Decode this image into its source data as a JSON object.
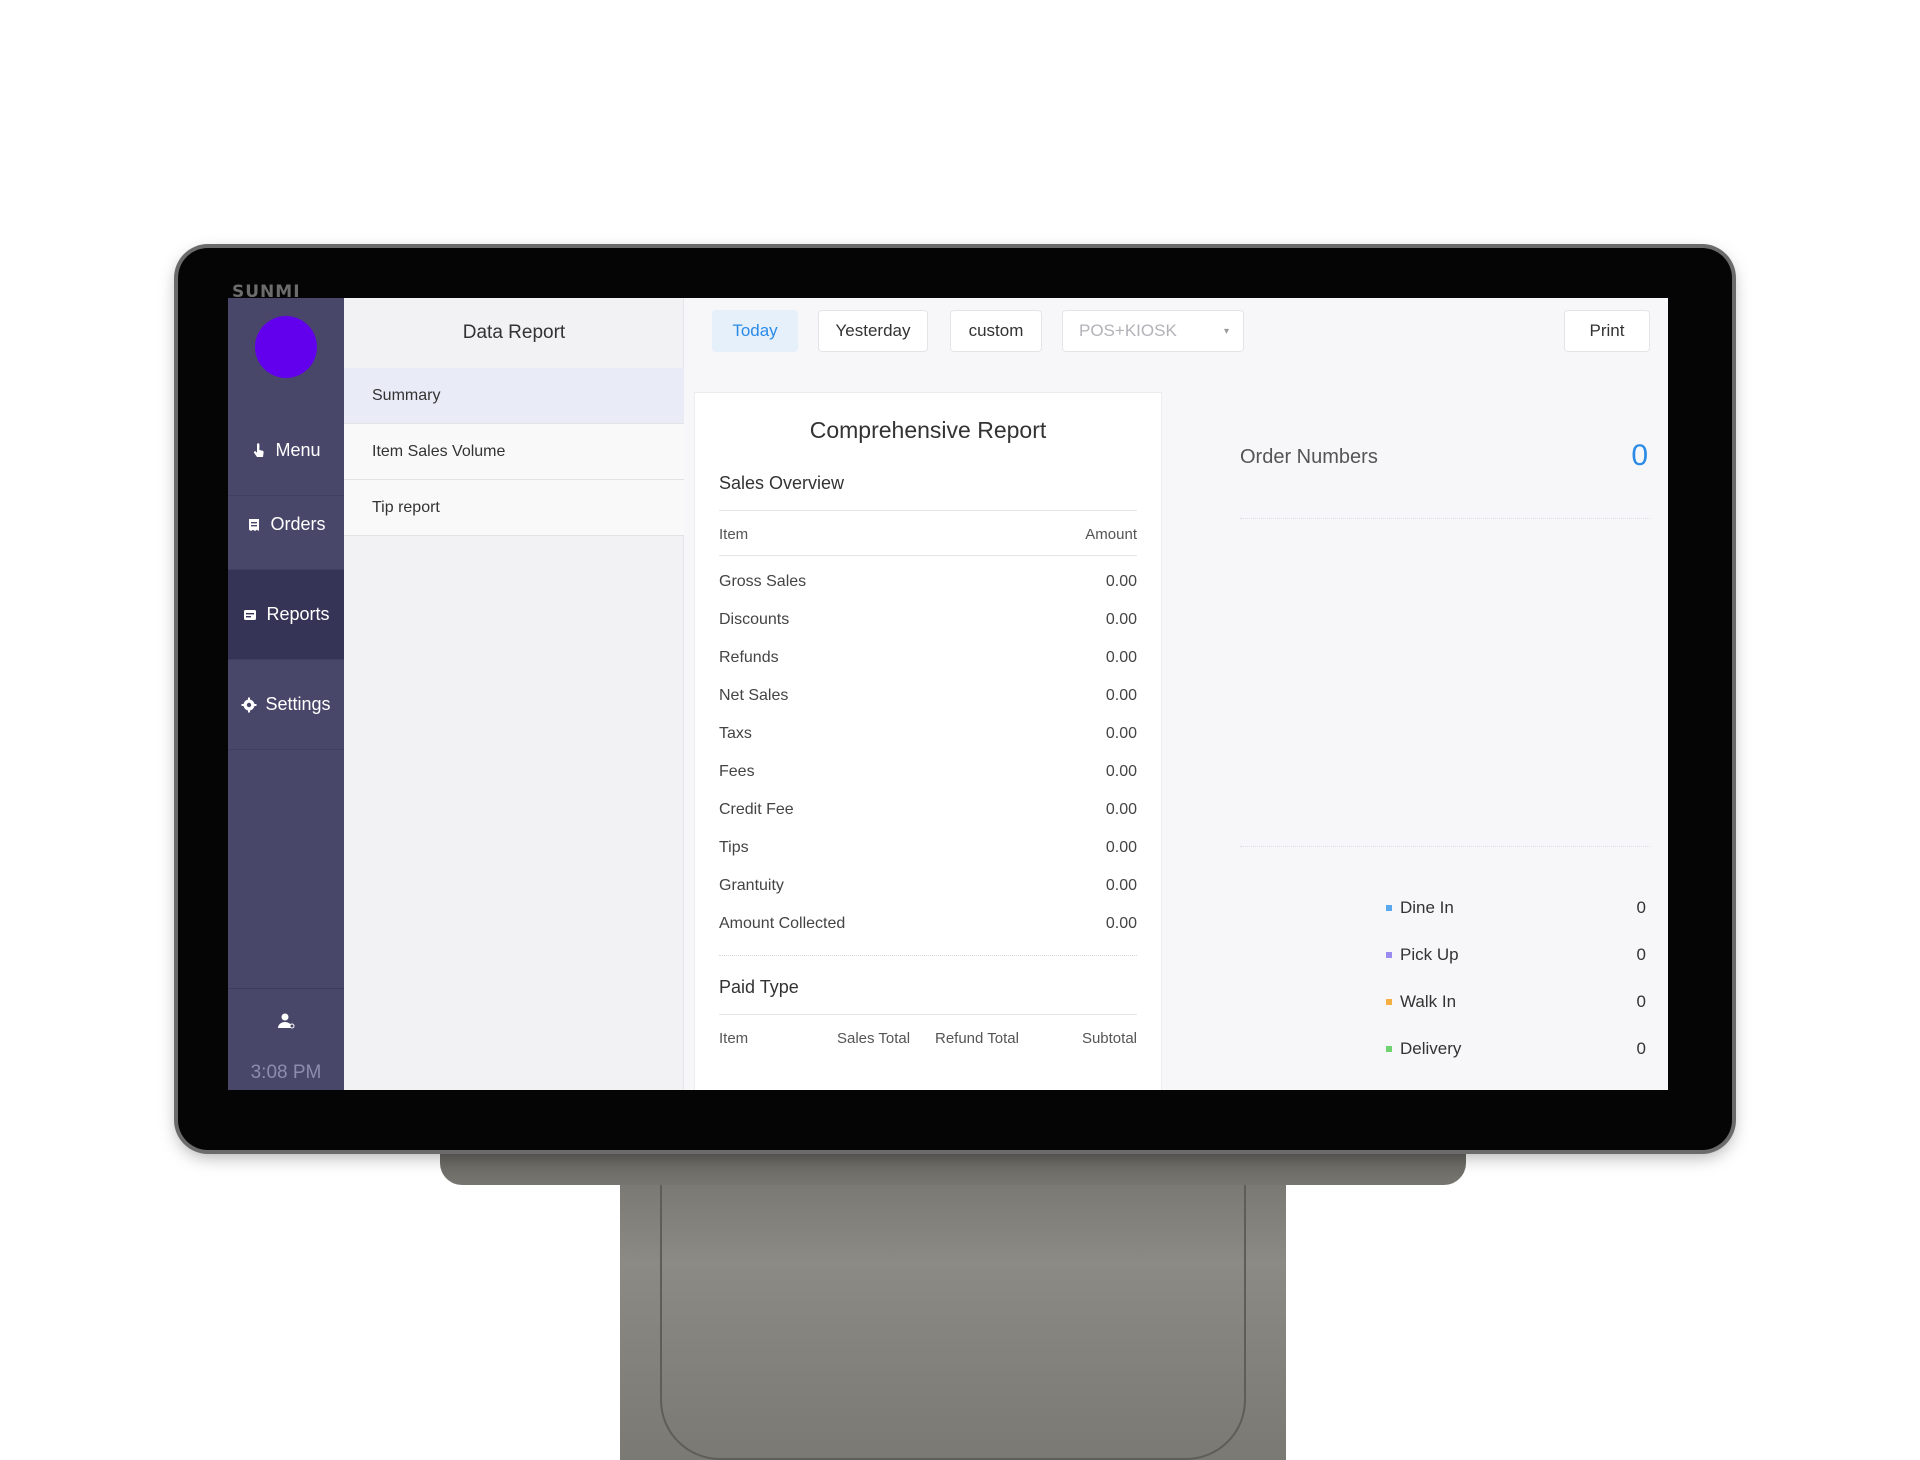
{
  "device": {
    "brand": "SUNMI"
  },
  "sidebar": {
    "items": [
      {
        "label": "Menu",
        "icon": "hand-pointer-icon"
      },
      {
        "label": "Orders",
        "icon": "receipt-icon"
      },
      {
        "label": "Reports",
        "icon": "report-icon"
      },
      {
        "label": "Settings",
        "icon": "gear-icon"
      }
    ],
    "active": "Reports",
    "time": "3:08 PM",
    "avatar_color": "#6200ee",
    "bg_color": "#48476a"
  },
  "subnav": {
    "title": "Data Report",
    "items": [
      {
        "label": "Summary"
      },
      {
        "label": "Item Sales Volume"
      },
      {
        "label": "Tip report"
      }
    ],
    "active": "Summary"
  },
  "toolbar": {
    "today_label": "Today",
    "yesterday_label": "Yesterday",
    "custom_label": "custom",
    "source_select": "POS+KIOSK",
    "print_label": "Print",
    "accent_color": "#2a8ae6"
  },
  "report": {
    "title": "Comprehensive Report",
    "sales_overview": {
      "title": "Sales Overview",
      "col_item": "Item",
      "col_amount": "Amount",
      "rows": [
        {
          "item": "Gross Sales",
          "amount": "0.00"
        },
        {
          "item": "Discounts",
          "amount": "0.00"
        },
        {
          "item": "Refunds",
          "amount": "0.00"
        },
        {
          "item": "Net Sales",
          "amount": "0.00"
        },
        {
          "item": "Taxs",
          "amount": "0.00"
        },
        {
          "item": "Fees",
          "amount": "0.00"
        },
        {
          "item": "Credit Fee",
          "amount": "0.00"
        },
        {
          "item": "Tips",
          "amount": "0.00"
        },
        {
          "item": "Grantuity",
          "amount": "0.00"
        },
        {
          "item": "Amount Collected",
          "amount": "0.00"
        }
      ]
    },
    "paid_type": {
      "title": "Paid Type",
      "columns": [
        "Item",
        "Sales Total",
        "Refund Total",
        "Subtotal"
      ]
    }
  },
  "orders": {
    "label": "Order Numbers",
    "value": "0",
    "breakdown": [
      {
        "label": "Dine In",
        "count": "0",
        "color": "#5aa9f0"
      },
      {
        "label": "Pick Up",
        "count": "0",
        "color": "#9b8cf0"
      },
      {
        "label": "Walk In",
        "count": "0",
        "color": "#f5b041"
      },
      {
        "label": "Delivery",
        "count": "0",
        "color": "#6fd36f"
      }
    ]
  }
}
